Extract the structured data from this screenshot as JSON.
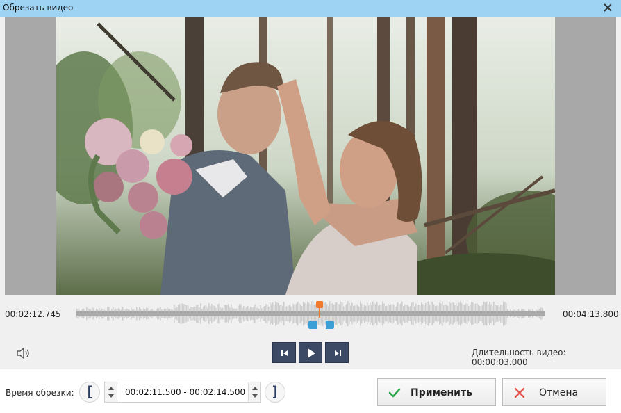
{
  "window": {
    "title": "Обрезать видео"
  },
  "timeline": {
    "start_time": "00:02:12.745",
    "end_time": "00:04:13.800",
    "playhead_fraction": 0.52
  },
  "playback": {
    "prev_label": "prev-frame",
    "play_label": "play",
    "next_label": "next-frame"
  },
  "duration": {
    "text": "Длительность видео: 00:00:03.000"
  },
  "trim": {
    "label": "Время обрезки:",
    "range_value": "00:02:11.500 - 00:02:14.500",
    "bracket_start": "[",
    "bracket_end": "]"
  },
  "buttons": {
    "apply_label": "Применить",
    "cancel_label": "Отмена"
  },
  "colors": {
    "titlebar": "#9fd3f4",
    "playhead": "#f07b2d",
    "trim_handle": "#3ca0d6",
    "control_bg": "#3c4a66",
    "apply_icon": "#2aa34a",
    "cancel_icon": "#e2554c"
  },
  "icons": {
    "close": "close-icon",
    "volume": "volume-icon",
    "apply": "checkmark-icon",
    "cancel": "cross-icon"
  }
}
